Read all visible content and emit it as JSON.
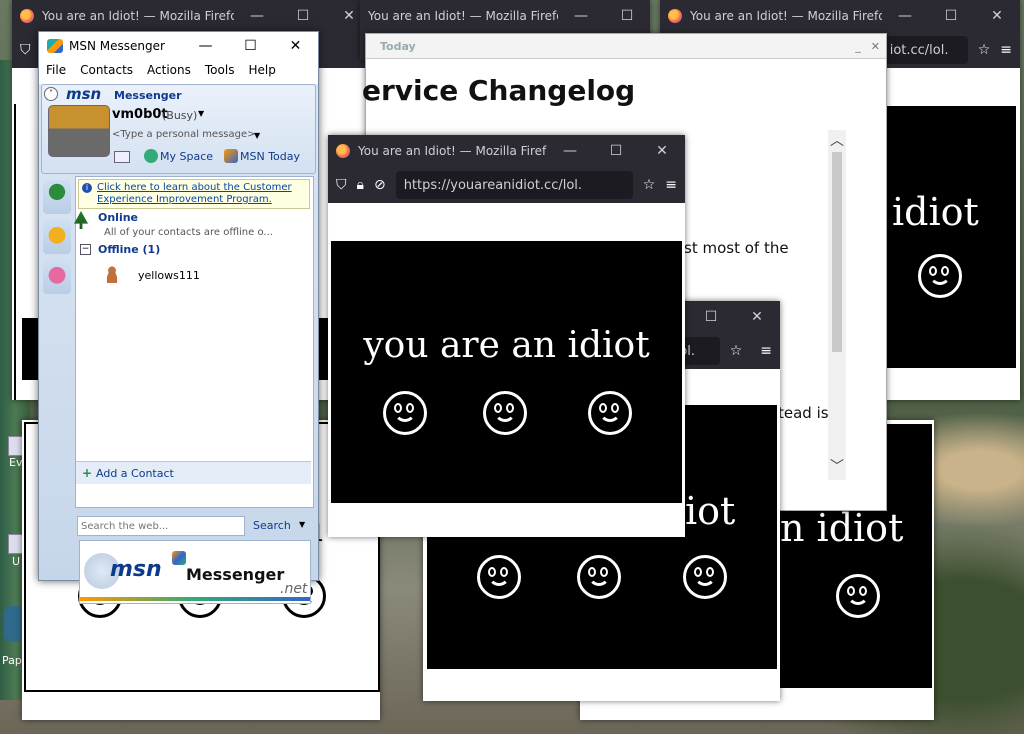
{
  "windows": {
    "ff_back_left": {
      "title": "You are an Idiot! — Mozilla Firefox"
    },
    "ff_back_mid": {
      "title": "You are an Idiot! — Mozilla Firefox"
    },
    "ff_back_right": {
      "title": "You are an Idiot! — Mozilla Firefox",
      "url": "iot.cc/lol."
    },
    "changelog": {
      "tab_title": "Today",
      "heading": "ervice Changelog",
      "text1": "st most of the",
      "text2": "tead is"
    },
    "ff_front": {
      "title": "You are an Idiot! — Mozilla Firefox",
      "url": "https://youareanidiot.cc/lol.",
      "message": "you are an idiot"
    },
    "ff_mid": {
      "url": "lol.",
      "message": "iot"
    },
    "ff_right_lower": {
      "message": "n idiot"
    },
    "ff_right_upper": {
      "message": "idiot"
    }
  },
  "desktop": {
    "icons": [
      {
        "label": "Ev"
      },
      {
        "label": "U"
      },
      {
        "label": "Pap"
      }
    ]
  },
  "msn": {
    "title": "MSN Messenger",
    "menu": [
      "File",
      "Contacts",
      "Actions",
      "Tools",
      "Help"
    ],
    "brand": "msn",
    "brand_sub": "Messenger",
    "username": "vm0b0t",
    "status": "(Busy)",
    "personal_message": "<Type a personal message>",
    "myspace": "My Space",
    "msn_today": "MSN Today",
    "ceip_link": "Click here to learn about the Customer Experience Improvement Program.",
    "group_online": "Online",
    "online_note": "All of your contacts are offline o...",
    "group_offline": "Offline (1)",
    "contact": "yellows111",
    "add_contact": "Add a Contact",
    "search_placeholder": "Search the web...",
    "search_button": "Search",
    "ad_brand": "msn",
    "ad_product": "Messenger",
    "ad_net": ".net"
  },
  "colors": {
    "ff_chrome": "#2b2a33",
    "msn_blue": "#0f3a8c",
    "idiot_bg": "#000000"
  }
}
